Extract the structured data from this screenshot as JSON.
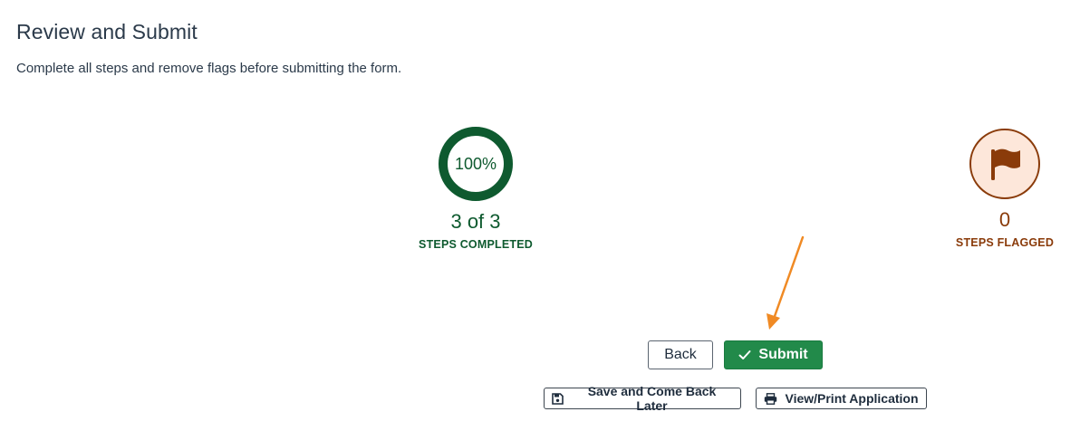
{
  "page": {
    "title": "Review and Submit",
    "subtitle": "Complete all steps and remove flags before submitting the form."
  },
  "progress": {
    "percent": 100,
    "percent_label": "100%",
    "completed_text": "3 of 3",
    "completed_caption": "STEPS COMPLETED",
    "color": "#0e5a2f"
  },
  "flags": {
    "count": "0",
    "caption": "STEPS FLAGGED",
    "icon": "flag-icon",
    "color": "#8a3b0a",
    "background": "#fde7da"
  },
  "actions": {
    "back_label": "Back",
    "submit_label": "Submit",
    "submit_icon": "check-icon",
    "save_label": "Save and Come Back Later",
    "save_icon": "save-icon",
    "print_label": "View/Print Application",
    "print_icon": "printer-icon",
    "submit_color": "#228a4a"
  },
  "annotation": {
    "arrow_color": "#f08a24"
  }
}
